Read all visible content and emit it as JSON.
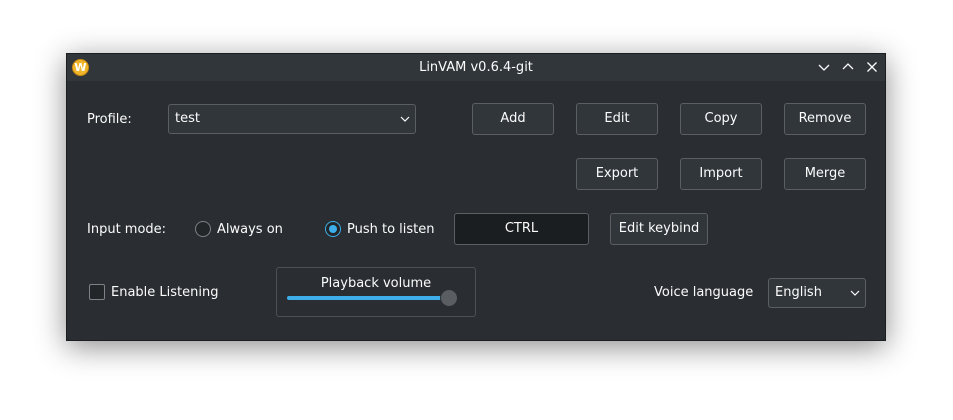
{
  "window": {
    "title": "LinVAM v0.6.4-git",
    "app_icon_letter": "W",
    "controls": [
      "minimize-icon",
      "maximize-icon",
      "close-icon"
    ]
  },
  "profile": {
    "label": "Profile:",
    "selected": "test",
    "buttons": {
      "add": "Add",
      "edit": "Edit",
      "copy": "Copy",
      "remove": "Remove",
      "export": "Export",
      "import": "Import",
      "merge": "Merge"
    }
  },
  "input_mode": {
    "label": "Input mode:",
    "options": {
      "always_on": "Always on",
      "push_to_listen": "Push to listen"
    },
    "selected": "push_to_listen",
    "keybind": "CTRL",
    "edit_keybind": "Edit keybind"
  },
  "listening": {
    "label": "Enable Listening",
    "checked": false
  },
  "playback": {
    "label": "Playback volume",
    "value_fraction": 0.95
  },
  "voice_language": {
    "label": "Voice language",
    "selected": "English"
  },
  "colors": {
    "accent": "#3daee9",
    "background": "#2a2e32",
    "button": "#31363b",
    "app_icon": "#f0b428"
  }
}
